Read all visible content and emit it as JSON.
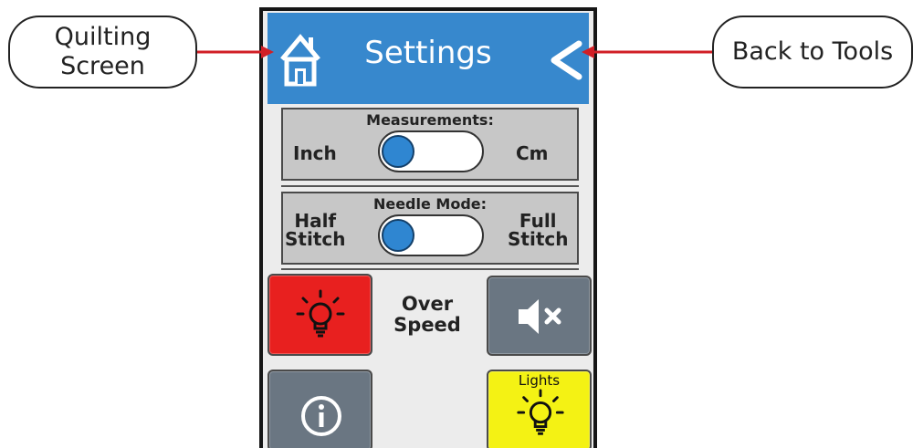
{
  "callouts": {
    "left": {
      "line1": "Quilting",
      "line2": "Screen"
    },
    "right": {
      "label": "Back to Tools"
    }
  },
  "header": {
    "title": "Settings",
    "home_icon": "home-icon",
    "back_icon": "chevron-left-icon",
    "color": "#3788cd"
  },
  "measurements": {
    "title": "Measurements:",
    "left_label": "Inch",
    "right_label": "Cm",
    "selected": "Inch"
  },
  "needle_mode": {
    "title": "Needle Mode:",
    "left_label_line1": "Half",
    "left_label_line2": "Stitch",
    "right_label_line1": "Full",
    "right_label_line2": "Stitch",
    "selected": "Half Stitch"
  },
  "buttons": {
    "over_speed_light": {
      "icon": "lightbulb-icon",
      "color": "#e8201f"
    },
    "over_speed_label_line1": "Over",
    "over_speed_label_line2": "Speed",
    "mute": {
      "icon": "speaker-mute-icon",
      "color": "#6a7682"
    },
    "info": {
      "icon": "info-icon",
      "color": "#6a7682"
    },
    "lights": {
      "label": "Lights",
      "icon": "lightbulb-icon",
      "color": "#f4f214"
    }
  },
  "arrow_color": "#d11f26"
}
